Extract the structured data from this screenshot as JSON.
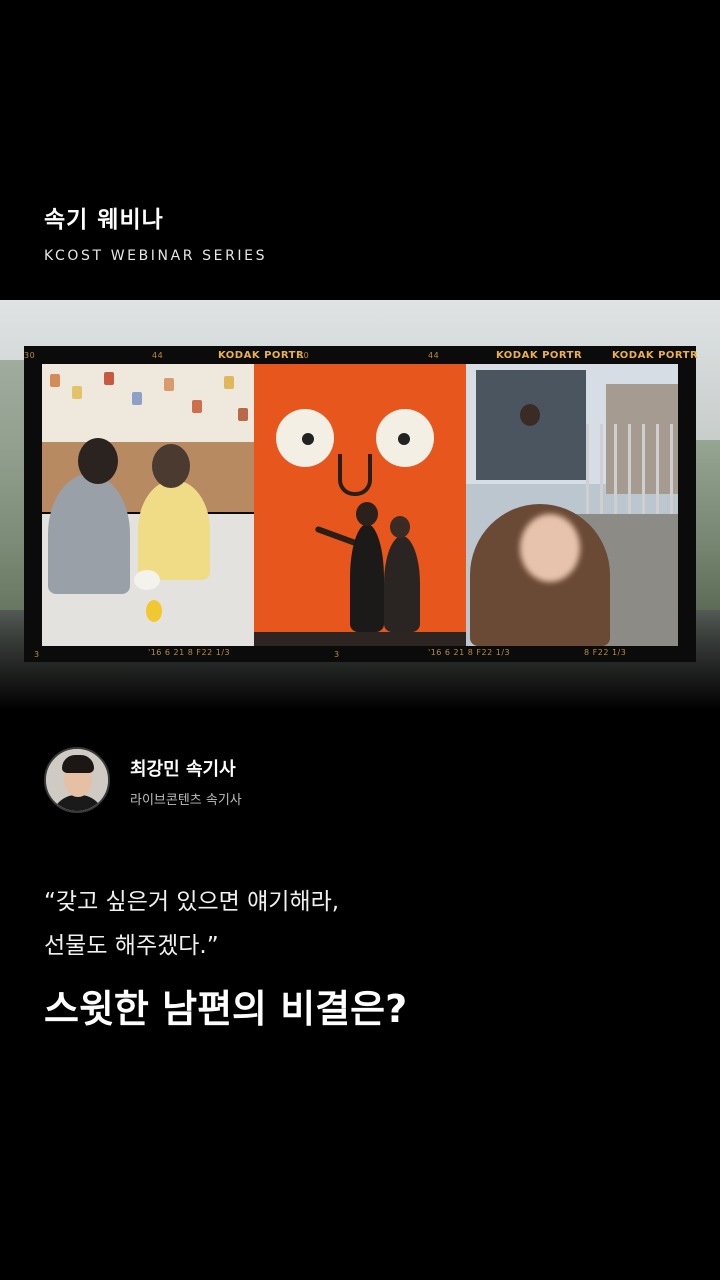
{
  "header": {
    "title": "속기 웨비나",
    "subtitle": "KCOST WEBINAR SERIES"
  },
  "film_strip": {
    "top_labels": [
      "30",
      "44",
      "KODAK PORTR",
      "30",
      "44",
      "KODAK PORTR",
      "KODAK PORTR"
    ],
    "bottom_labels": [
      "3",
      "'16  6 21 8 F22  1/3",
      "3",
      "'16  6 21 8 F22  1/3",
      "8 F22  1/3"
    ],
    "frames": [
      "pottery-class-photo",
      "orange-wall-photo",
      "train-station-photo"
    ]
  },
  "author": {
    "name": "최강민 속기사",
    "role": "라이브콘텐츠 속기사"
  },
  "quote": {
    "line1": "“갖고 싶은거 있으면 얘기해라,",
    "line2": "선물도 해주겠다.”"
  },
  "headline": "스윗한 남편의 비결은?"
}
